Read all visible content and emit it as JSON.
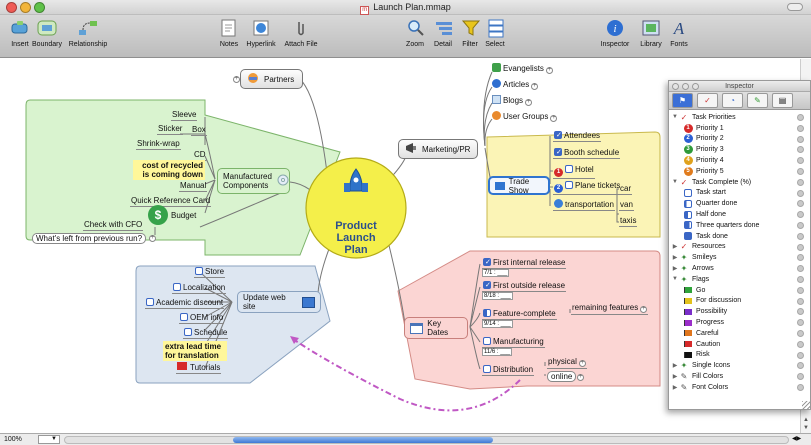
{
  "window": {
    "title": "Launch Plan.mmap"
  },
  "toolbar": {
    "insert": "Insert",
    "boundary": "Boundary",
    "relationship": "Relationship",
    "notes": "Notes",
    "hyperlink": "Hyperlink",
    "attach": "Attach File",
    "zoom": "Zoom",
    "detail": "Detail",
    "filter": "Filter",
    "select": "Select",
    "inspector": "Inspector",
    "library": "Library",
    "fonts": "Fonts"
  },
  "map": {
    "central": [
      "Product",
      "Launch",
      "Plan"
    ],
    "partners": "Partners",
    "marketing": "Marketing/PR",
    "marketing_children": [
      "Evangelists",
      "Articles",
      "Blogs",
      "User Groups"
    ],
    "trade_show": "Trade Show",
    "trade_children": [
      "Attendees",
      "Booth schedule",
      "Hotel",
      "Plane tickets",
      "transportation"
    ],
    "transport_children": [
      "car",
      "van",
      "taxis"
    ],
    "manufactured": [
      "Manufactured",
      "Components"
    ],
    "box": "Box",
    "box_children": [
      "Sleeve",
      "Sticker",
      "Shrink-wrap"
    ],
    "manu_children": [
      "CD",
      "Manual",
      "Quick Reference Card"
    ],
    "cost_note": [
      "cost of recycled",
      "is coming down"
    ],
    "budget": "Budget",
    "budget_children": [
      "Check with CFO",
      "What's left from previous run?"
    ],
    "key_dates": "Key Dates",
    "dates": [
      {
        "label": "First internal release",
        "date": "7/1 : ___"
      },
      {
        "label": "First outside release",
        "date": "8/18 : ___"
      },
      {
        "label": "Feature-complete",
        "date": "9/14 : ___"
      },
      {
        "label": "Manufacturing",
        "date": "11/6 : ___"
      }
    ],
    "remaining": "remaining features",
    "distribution": "Distribution",
    "dist_children": [
      "physical",
      "online"
    ],
    "website": "Update web site",
    "web_children": [
      "Store",
      "Localization",
      "Academic discount",
      "OEM info",
      "Schedule",
      "Tutorials"
    ],
    "lead_note": [
      "extra lead time",
      "for translation"
    ]
  },
  "inspector": {
    "title": "Inspector",
    "rows": [
      {
        "label": "Task Priorities",
        "level": 1,
        "open": true,
        "icon": "task-icon"
      },
      {
        "label": "Priority 1",
        "level": 2,
        "icon": "priority-1-icon",
        "color": "#d62a2a",
        "n": "1"
      },
      {
        "label": "Priority 2",
        "level": 2,
        "icon": "priority-2-icon",
        "color": "#2b5fd4",
        "n": "2"
      },
      {
        "label": "Priority 3",
        "level": 2,
        "icon": "priority-3-icon",
        "color": "#2f9a3a",
        "n": "3"
      },
      {
        "label": "Priority 4",
        "level": 2,
        "icon": "priority-4-icon",
        "color": "#e0a21d",
        "n": "4"
      },
      {
        "label": "Priority 5",
        "level": 2,
        "icon": "priority-5-icon",
        "color": "#e07b1d",
        "n": "5"
      },
      {
        "label": "Task Complete (%)",
        "level": 1,
        "open": true,
        "icon": "task-icon"
      },
      {
        "label": "Task start",
        "level": 2,
        "icon": "progress-0-icon",
        "pct": "0"
      },
      {
        "label": "Quarter done",
        "level": 2,
        "icon": "progress-25-icon",
        "pct": "25"
      },
      {
        "label": "Half done",
        "level": 2,
        "icon": "progress-50-icon",
        "pct": "50"
      },
      {
        "label": "Three quarters done",
        "level": 2,
        "icon": "progress-75-icon",
        "pct": "75"
      },
      {
        "label": "Task done",
        "level": 2,
        "icon": "progress-100-icon",
        "pct": "100"
      },
      {
        "label": "Resources",
        "level": 1,
        "open": false,
        "icon": "task-icon"
      },
      {
        "label": "Smileys",
        "level": 1,
        "open": false,
        "icon": "signpost-icon"
      },
      {
        "label": "Arrows",
        "level": 1,
        "open": false,
        "icon": "signpost-icon"
      },
      {
        "label": "Flags",
        "level": 1,
        "open": true,
        "icon": "signpost-icon"
      },
      {
        "label": "Go",
        "level": 2,
        "icon": "flag-icon",
        "color": "#2fa33a"
      },
      {
        "label": "For discussion",
        "level": 2,
        "icon": "flag-icon",
        "color": "#e3c21c"
      },
      {
        "label": "Possibility",
        "level": 2,
        "icon": "flag-icon",
        "color": "#7a2ec9"
      },
      {
        "label": "Progress",
        "level": 2,
        "icon": "flag-icon",
        "color": "#9a2ec9"
      },
      {
        "label": "Careful",
        "level": 2,
        "icon": "flag-icon",
        "color": "#e0761d"
      },
      {
        "label": "Caution",
        "level": 2,
        "icon": "flag-icon",
        "color": "#d62a2a"
      },
      {
        "label": "Risk",
        "level": 2,
        "icon": "flag-icon",
        "color": "#111111"
      },
      {
        "label": "Single Icons",
        "level": 1,
        "open": false,
        "icon": "signpost-icon"
      },
      {
        "label": "Fill Colors",
        "level": 1,
        "open": false,
        "icon": "brush-icon"
      },
      {
        "label": "Font Colors",
        "level": 1,
        "open": false,
        "icon": "brush-icon"
      }
    ]
  },
  "status": {
    "zoom": "100%"
  },
  "colors": {
    "central": "#f4ef4a",
    "manufactured": "#d8f5cc",
    "marketing": "#fbf4b6",
    "keydates": "#fbd3d1",
    "website": "#dbe5f1",
    "relationship": "#c058c4"
  }
}
